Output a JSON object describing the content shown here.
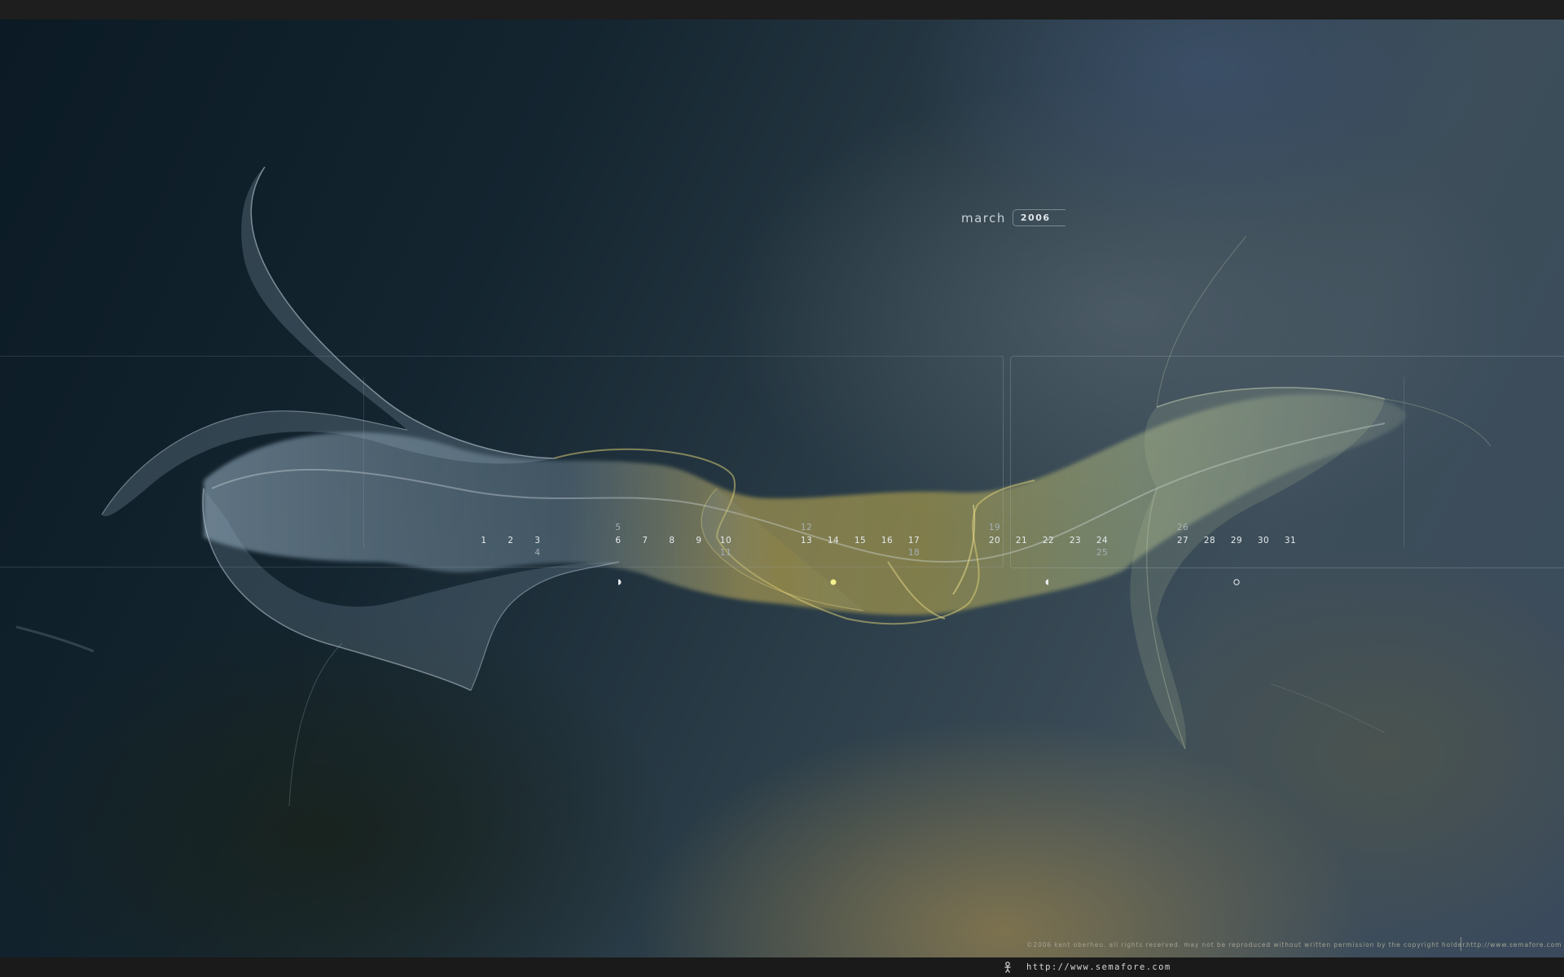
{
  "calendar": {
    "month": "march",
    "year": "2006",
    "days": {
      "d1": "1",
      "d2": "2",
      "d3": "3",
      "d4": "4",
      "d5": "5",
      "d6": "6",
      "d7": "7",
      "d8": "8",
      "d9": "9",
      "d10": "10",
      "d11": "11",
      "d12": "12",
      "d13": "13",
      "d14": "14",
      "d15": "15",
      "d16": "16",
      "d17": "17",
      "d18": "18",
      "d19": "19",
      "d20": "20",
      "d21": "21",
      "d22": "22",
      "d23": "23",
      "d24": "24",
      "d25": "25",
      "d26": "26",
      "d27": "27",
      "d28": "28",
      "d29": "29",
      "d30": "30",
      "d31": "31"
    },
    "moon_phases": [
      "first-quarter-moon-icon",
      "full-moon-icon",
      "last-quarter-moon-icon",
      "new-moon-icon"
    ]
  },
  "footer": {
    "copyright": "©2006 kent oberheu.  all rights reserved.  may not be reproduced without written permission by the copyright holder.",
    "url_small": "http://www.semafore.com"
  },
  "taskbar": {
    "icon": "figure-icon",
    "url": "http://www.semafore.com"
  },
  "colors": {
    "background_dark": "#0b1a24",
    "background_mid": "#3d4e5a",
    "glow_bottom": "#80744e",
    "wave_blue": "#9fb6c8",
    "wave_gold": "#c9b25a",
    "wave_green": "#b8c68c",
    "full_moon": "#f2f08a"
  }
}
